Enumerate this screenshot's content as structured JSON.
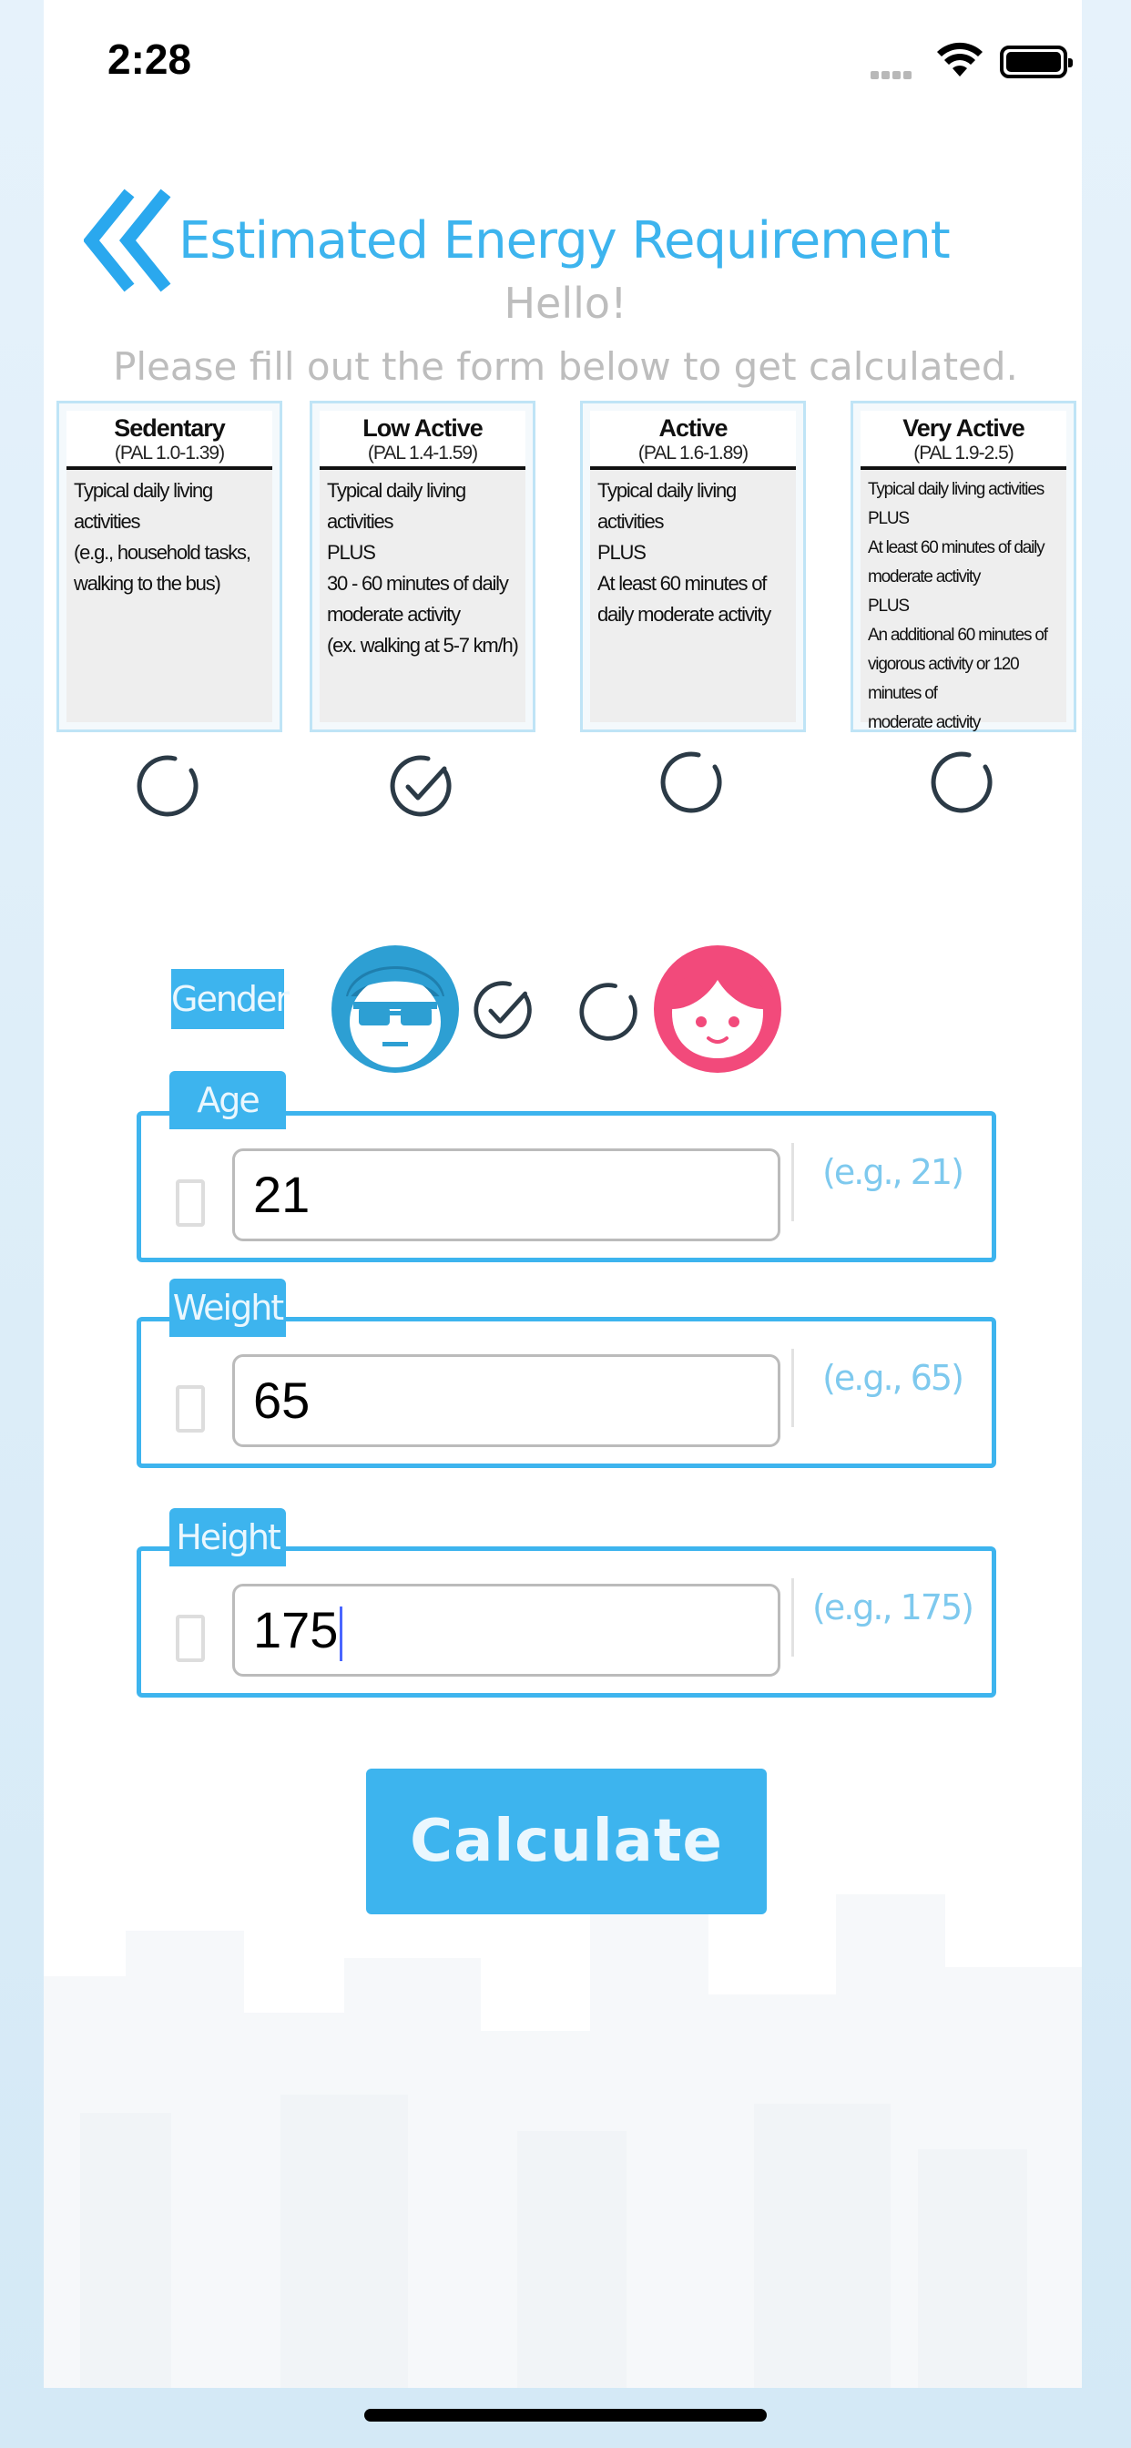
{
  "status": {
    "time": "2:28"
  },
  "header": {
    "title": "Estimated Energy Requirement",
    "greeting": "Hello!",
    "instruction": "Please fill out the form below to get calculated."
  },
  "activity_levels": [
    {
      "name": "Sedentary",
      "pal": "(PAL 1.0-1.39)",
      "desc": "Typical daily living\nactivities\n(e.g., household tasks,\nwalking to the bus)",
      "selected": false
    },
    {
      "name": "Low Active",
      "pal": "(PAL 1.4-1.59)",
      "desc": "Typical daily living\nactivities\nPLUS\n30 - 60 minutes of daily\nmoderate activity\n(ex. walking at 5-7 km/h)",
      "selected": true
    },
    {
      "name": "Active",
      "pal": "(PAL 1.6-1.89)",
      "desc": "Typical daily living\nactivities\nPLUS\nAt least 60 minutes of\ndaily moderate activity",
      "selected": false
    },
    {
      "name": "Very Active",
      "pal": "(PAL 1.9-2.5)",
      "desc": "Typical daily living activities\nPLUS\nAt least 60 minutes of daily\nmoderate activity\nPLUS\nAn additional 60 minutes of\nvigorous activity or 120 minutes of\nmoderate activity",
      "selected": false
    }
  ],
  "gender": {
    "label": "Gender",
    "selected": "male"
  },
  "fields": {
    "age": {
      "label": "Age",
      "value": "21",
      "hint": "(e.g., 21)"
    },
    "weight": {
      "label": "Weight",
      "value": "65",
      "hint": "(e.g., 65)"
    },
    "height": {
      "label": "Height",
      "value": "175",
      "hint": "(e.g., 175)"
    }
  },
  "actions": {
    "calculate": "Calculate"
  },
  "colors": {
    "accent": "#3db4ee",
    "female": "#f24a7b",
    "radio": "#2b3a46"
  }
}
